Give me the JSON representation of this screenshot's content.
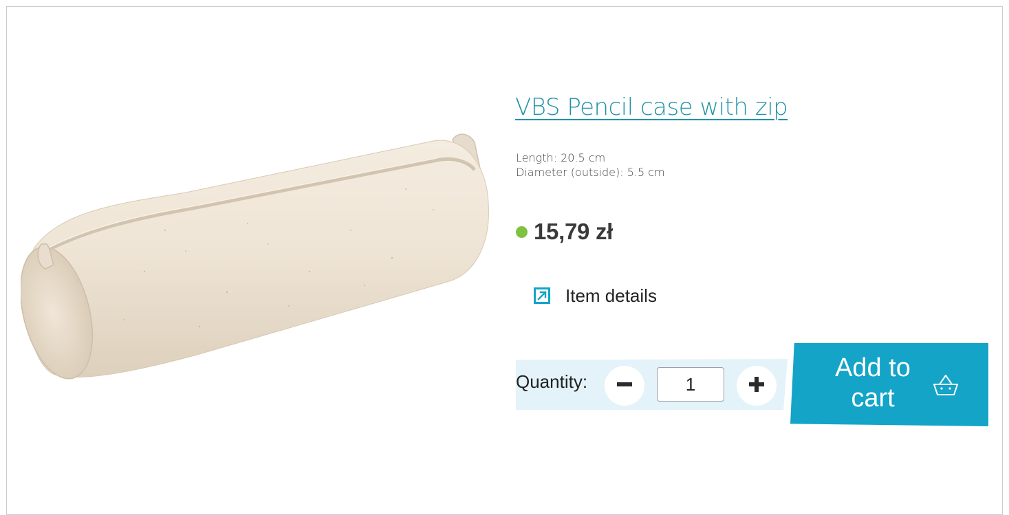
{
  "product": {
    "title": "VBS Pencil case with zip",
    "specs": {
      "length": "Length: 20.5 cm",
      "diameter": "Diameter (outside): 5.5 cm"
    },
    "price": "15,79 zł",
    "stock_color": "#7fc241",
    "image_icon": "pencil-case-image"
  },
  "details_link": {
    "label": "Item details",
    "icon": "external-link-icon"
  },
  "quantity": {
    "label": "Quantity:",
    "value": "1",
    "minus_icon": "minus-icon",
    "plus_icon": "plus-icon"
  },
  "cart_button": {
    "label": "Add to cart",
    "icon": "basket-icon"
  },
  "colors": {
    "accent": "#13a4c8",
    "title": "#1f93a8",
    "quantity_bg": "#e3f3f9"
  }
}
